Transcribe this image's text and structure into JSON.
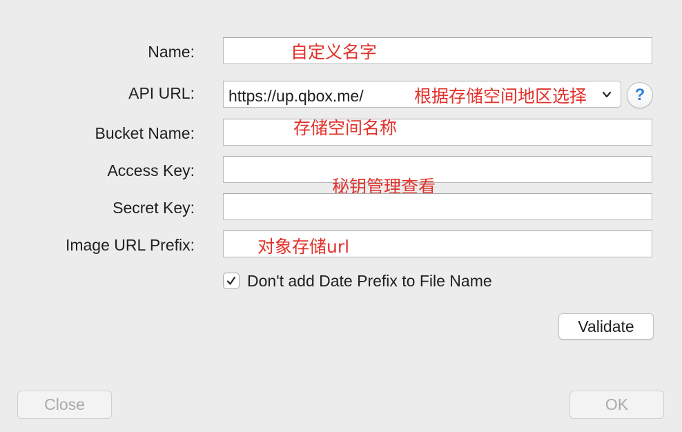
{
  "form": {
    "name": {
      "label": "Name:",
      "value": "",
      "annotation": "自定义名字"
    },
    "api_url": {
      "label": "API URL:",
      "value": "https://up.qbox.me/",
      "annotation": "根据存储空间地区选择",
      "help": "?"
    },
    "bucket_name": {
      "label": "Bucket Name:",
      "value": "",
      "annotation": "存储空间名称"
    },
    "access_key": {
      "label": "Access Key:",
      "value": "",
      "annotation": "秘钥管理查看"
    },
    "secret_key": {
      "label": "Secret Key:",
      "value": ""
    },
    "image_url_prefix": {
      "label": "Image URL Prefix:",
      "value": "",
      "annotation": "对象存储url"
    },
    "date_prefix_checkbox": {
      "label": "Don't add Date Prefix to File Name",
      "checked": true
    }
  },
  "buttons": {
    "validate": "Validate",
    "close": "Close",
    "ok": "OK"
  },
  "colors": {
    "annotation": "#e0312a",
    "help_icon": "#2b7fd6",
    "background": "#ececec"
  }
}
